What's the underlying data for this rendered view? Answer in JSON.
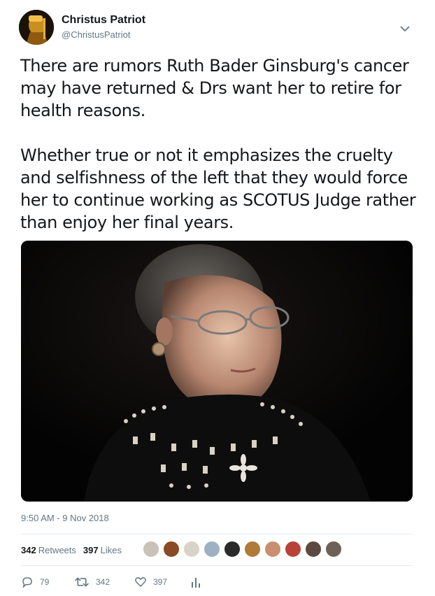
{
  "account": {
    "display_name": "Christus Patriot",
    "handle": "@ChristusPatriot"
  },
  "tweet": {
    "paragraphs": [
      "There are rumors Ruth Bader Ginsburg's cancer may have returned & Drs want her to retire for health reasons.",
      "Whether true or not it emphasizes the cruelty and selfishness of the left that they would force her to continue working as SCOTUS Judge rather than enjoy her final years."
    ],
    "timestamp": "9:50 AM - 9 Nov 2018"
  },
  "stats": {
    "retweets_count": "342",
    "retweets_label": "Retweets",
    "likes_count": "397",
    "likes_label": "Likes"
  },
  "actions": {
    "reply_count": "79",
    "retweet_count": "342",
    "like_count": "397"
  },
  "likers": [
    {
      "icon": "liker-avatar",
      "color": "#c9c2b8"
    },
    {
      "icon": "liker-avatar",
      "color": "#8a4a24"
    },
    {
      "icon": "liker-avatar",
      "color": "#d8d2c8"
    },
    {
      "icon": "liker-avatar",
      "color": "#9fb0c2"
    },
    {
      "icon": "liker-avatar",
      "color": "#2a2a2a"
    },
    {
      "icon": "liker-avatar",
      "color": "#b07a3a"
    },
    {
      "icon": "liker-avatar",
      "color": "#c98f70"
    },
    {
      "icon": "liker-avatar",
      "color": "#b8413a"
    },
    {
      "icon": "liker-avatar",
      "color": "#5a4a40"
    },
    {
      "icon": "liker-avatar",
      "color": "#6d6257"
    }
  ],
  "colors": {
    "text": "#14171a",
    "secondary": "#657786",
    "divider": "#e6ecf0"
  }
}
